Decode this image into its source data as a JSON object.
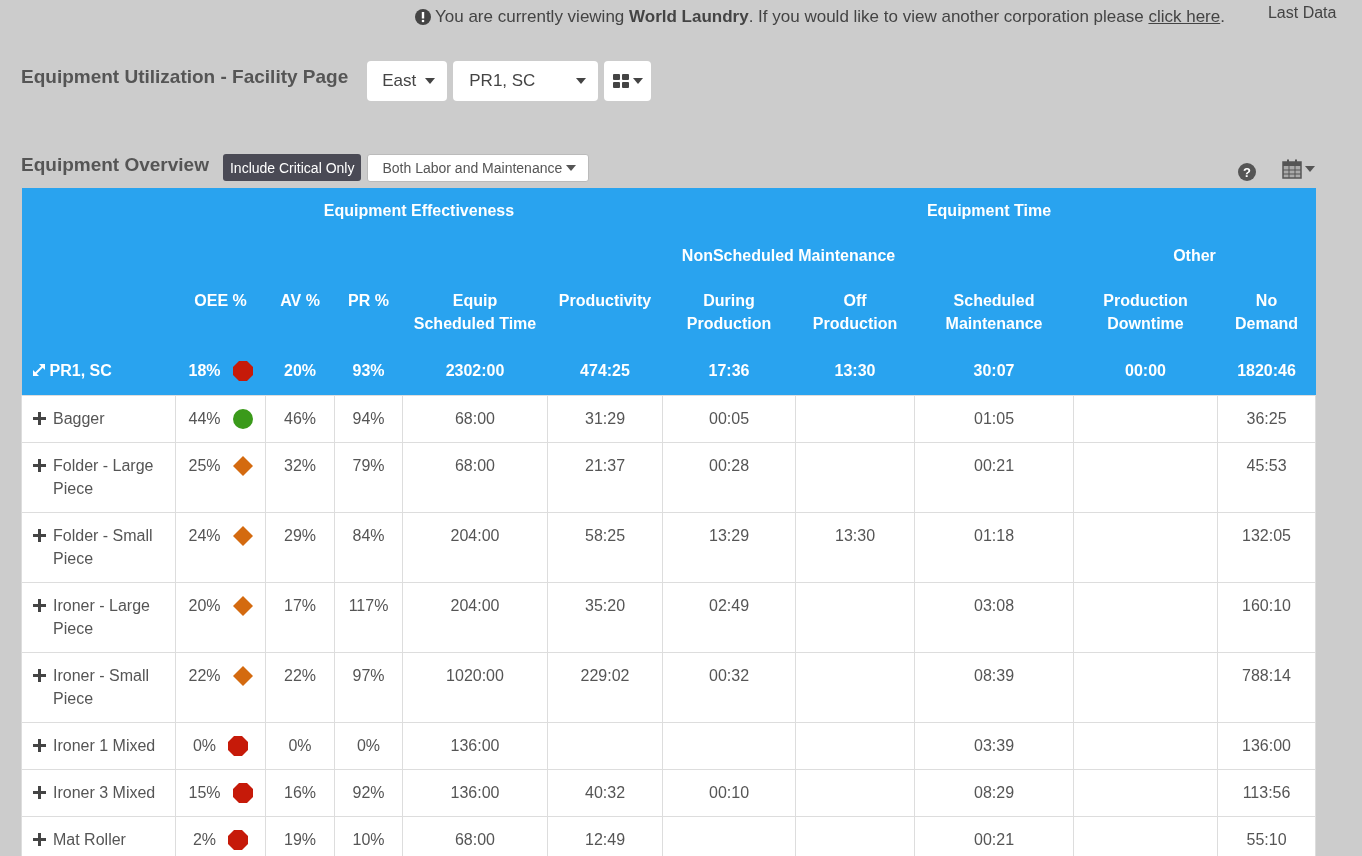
{
  "notice": {
    "text": "You are currently viewing **World Laundry**. If you would like to view another corporation please",
    "link": "click here",
    "end": ".",
    "last_data": "Last Data"
  },
  "header": {
    "title": "Equipment Utilization - Facility Page",
    "region": "East",
    "facility": "PR1, SC"
  },
  "toolbar": {
    "title": "Equipment Overview",
    "critical_button": "Include Critical Only",
    "labor_filter": "Both Labor and Maintenance",
    "help": "?"
  },
  "table": {
    "groups": [
      {
        "label": "Equipment Effectiveness",
        "subgroups": [
          {
            "columns": [
              "OEE %",
              "AV %",
              "PR %",
              "Equip Scheduled Time",
              "Productivity"
            ]
          }
        ]
      },
      {
        "label": "Equipment Time",
        "subgroups": [
          {
            "label": "NonScheduled Maintenance",
            "columns": [
              "During Production",
              "Off Production"
            ]
          },
          {
            "columns": [
              "Scheduled Maintenance"
            ]
          },
          {
            "label": "Other",
            "columns": [
              "Production Downtime",
              "No Demand"
            ]
          }
        ]
      }
    ],
    "summary": {
      "name": "PR1, SC",
      "oee": "18%",
      "indicator": {
        "kind": "octagon",
        "color": "#c61a09"
      },
      "av": "20%",
      "pr": "93%",
      "equip_scheduled_time": "2302:00",
      "productivity": "474:25",
      "during_production": "17:36",
      "off_production": "13:30",
      "scheduled_maintenance": "30:07",
      "production_downtime": "00:00",
      "no_demand": "1820:46"
    },
    "rows": [
      {
        "name": "Bagger",
        "expanded": false,
        "oee": "44%",
        "indicator": {
          "kind": "circle",
          "color": "#3a9a1a"
        },
        "av": "46%",
        "pr": "94%",
        "equip_scheduled_time": "68:00",
        "productivity": "31:29",
        "during_production": "00:05",
        "scheduled_maintenance": "01:05",
        "no_demand": "36:25"
      },
      {
        "name": "Folder - Large Piece",
        "expanded": false,
        "oee": "25%",
        "indicator": {
          "kind": "diamond",
          "color": "#d46a0f"
        },
        "av": "32%",
        "pr": "79%",
        "equip_scheduled_time": "68:00",
        "productivity": "21:37",
        "during_production": "00:28",
        "scheduled_maintenance": "00:21",
        "no_demand": "45:53"
      },
      {
        "name": "Folder - Small Piece",
        "expanded": false,
        "oee": "24%",
        "indicator": {
          "kind": "diamond",
          "color": "#d46a0f"
        },
        "av": "29%",
        "pr": "84%",
        "equip_scheduled_time": "204:00",
        "productivity": "58:25",
        "during_production": "13:29",
        "off_production": "13:30",
        "scheduled_maintenance": "01:18",
        "no_demand": "132:05"
      },
      {
        "name": "Ironer - Large Piece",
        "expanded": false,
        "oee": "20%",
        "indicator": {
          "kind": "diamond",
          "color": "#d46a0f"
        },
        "av": "17%",
        "pr": "117%",
        "equip_scheduled_time": "204:00",
        "productivity": "35:20",
        "during_production": "02:49",
        "scheduled_maintenance": "03:08",
        "no_demand": "160:10"
      },
      {
        "name": "Ironer - Small Piece",
        "expanded": false,
        "oee": "22%",
        "indicator": {
          "kind": "diamond",
          "color": "#d46a0f"
        },
        "av": "22%",
        "pr": "97%",
        "equip_scheduled_time": "1020:00",
        "productivity": "229:02",
        "during_production": "00:32",
        "scheduled_maintenance": "08:39",
        "no_demand": "788:14"
      },
      {
        "name": "Ironer 1 Mixed",
        "expanded": false,
        "oee": "0%",
        "indicator": {
          "kind": "octagon",
          "color": "#c61a09"
        },
        "av": "0%",
        "pr": "0%",
        "equip_scheduled_time": "136:00",
        "scheduled_maintenance": "03:39",
        "no_demand": "136:00"
      },
      {
        "name": "Ironer 3 Mixed",
        "expanded": false,
        "oee": "15%",
        "indicator": {
          "kind": "octagon",
          "color": "#c61a09"
        },
        "av": "16%",
        "pr": "92%",
        "equip_scheduled_time": "136:00",
        "productivity": "40:32",
        "during_production": "00:10",
        "scheduled_maintenance": "08:29",
        "no_demand": "113:56"
      },
      {
        "name": "Mat Roller",
        "expanded": false,
        "oee": "2%",
        "indicator": {
          "kind": "octagon",
          "color": "#c61a09"
        },
        "av": "19%",
        "pr": "10%",
        "equip_scheduled_time": "68:00",
        "productivity": "12:49",
        "scheduled_maintenance": "00:21",
        "no_demand": "55:10"
      }
    ]
  }
}
